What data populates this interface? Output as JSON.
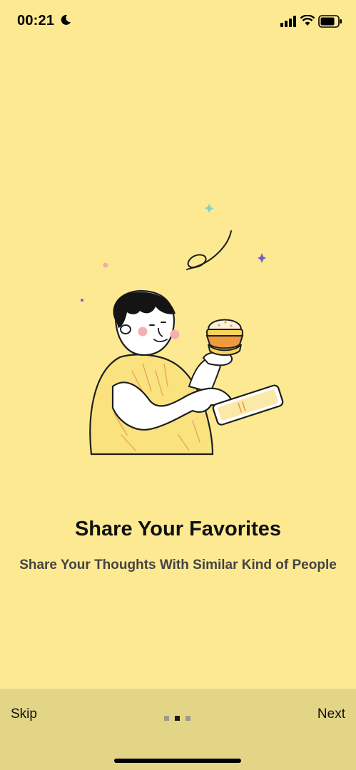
{
  "status_bar": {
    "time": "00:21"
  },
  "onboarding": {
    "title": "Share Your Favorites",
    "subtitle": "Share Your Thoughts With Similar Kind of People",
    "page_index": 2,
    "page_count": 3
  },
  "nav": {
    "skip_label": "Skip",
    "next_label": "Next"
  },
  "colors": {
    "background": "#FDE992",
    "bottom_bar": "#E2D586",
    "shirt": "#FAE27E"
  },
  "icons": [
    "moon-icon",
    "cellular-signal-icon",
    "wifi-icon",
    "battery-icon"
  ]
}
